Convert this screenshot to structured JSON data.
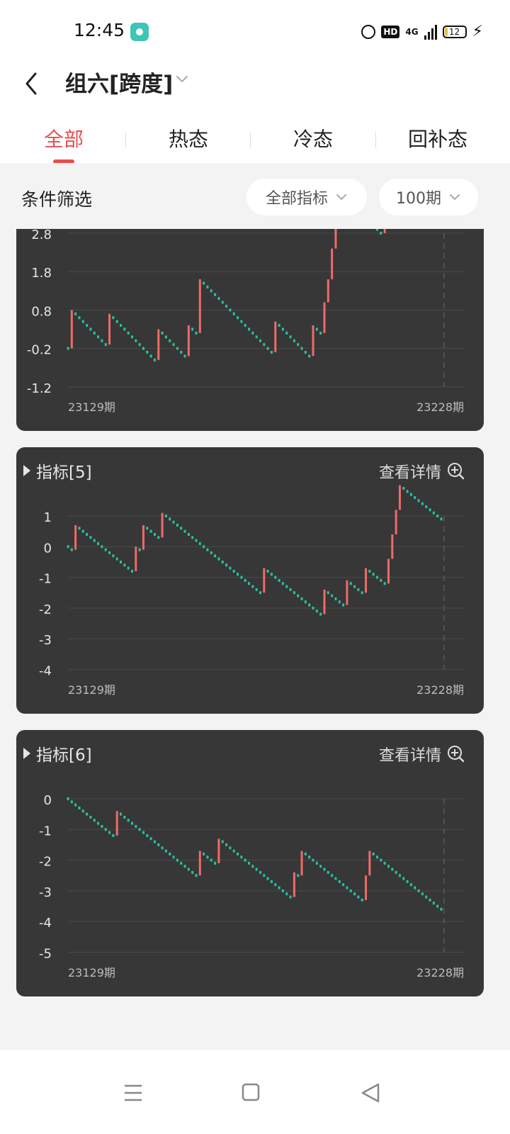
{
  "status_bar": {
    "time": "12:45",
    "hd": "HD",
    "network": "4G",
    "battery": "12"
  },
  "header": {
    "back_icon": "chevron-left-icon",
    "title": "组六[跨度]",
    "title_icon": "chevron-down-icon"
  },
  "tabs": [
    {
      "label": "全部",
      "active": true
    },
    {
      "label": "热态",
      "active": false
    },
    {
      "label": "冷态",
      "active": false
    },
    {
      "label": "回补态",
      "active": false
    }
  ],
  "filter": {
    "label": "条件筛选",
    "indicator_select": "全部指标",
    "period_select": "100期"
  },
  "colors": {
    "up": "#f06a6a",
    "down": "#27c4a0",
    "accent": "#e94d4d",
    "card_bg": "#373737"
  },
  "charts": [
    {
      "title": "",
      "detail_label": "",
      "yticks": [
        "2.8",
        "1.8",
        "0.8",
        "-0.2",
        "-1.2"
      ],
      "x_start": "23129期",
      "x_end": "23228期",
      "start_value": -0.2,
      "up_moves": [
        [
          1,
          1.0
        ],
        [
          11,
          0.8
        ],
        [
          24,
          0.8
        ],
        [
          32,
          0.8
        ],
        [
          35,
          1.4
        ],
        [
          55,
          0.8
        ],
        [
          65,
          0.8
        ],
        [
          68,
          0.8
        ],
        [
          69,
          0.6
        ],
        [
          70,
          0.8
        ],
        [
          71,
          0.7
        ],
        [
          72,
          0.8
        ],
        [
          84,
          0.8
        ],
        [
          91,
          0.8
        ]
      ]
    },
    {
      "title": "指标[5]",
      "detail_label": "查看详情",
      "yticks": [
        "1",
        "0",
        "-1",
        "-2",
        "-3",
        "-4"
      ],
      "x_start": "23129期",
      "x_end": "23228期",
      "start_value": 0,
      "up_moves": [
        [
          2,
          0.8
        ],
        [
          18,
          0.8
        ],
        [
          20,
          0.8
        ],
        [
          25,
          0.8
        ],
        [
          52,
          0.8
        ],
        [
          68,
          0.8
        ],
        [
          74,
          0.8
        ],
        [
          79,
          0.8
        ],
        [
          85,
          0.8
        ],
        [
          86,
          0.8
        ],
        [
          87,
          0.8
        ],
        [
          88,
          0.8
        ]
      ]
    },
    {
      "title": "指标[6]",
      "detail_label": "查看详情",
      "yticks": [
        "0",
        "-1",
        "-2",
        "-3",
        "-4",
        "-5"
      ],
      "x_start": "23129期",
      "x_end": "23228期",
      "start_value": 0,
      "up_moves": [
        [
          13,
          0.8
        ],
        [
          35,
          0.8
        ],
        [
          40,
          0.8
        ],
        [
          60,
          0.8
        ],
        [
          62,
          0.8
        ],
        [
          79,
          0.8
        ],
        [
          80,
          0.8
        ]
      ]
    }
  ],
  "bottom_nav": {
    "menu_icon": "menu-icon",
    "home_icon": "home-square-icon",
    "back_icon": "back-triangle-icon"
  }
}
